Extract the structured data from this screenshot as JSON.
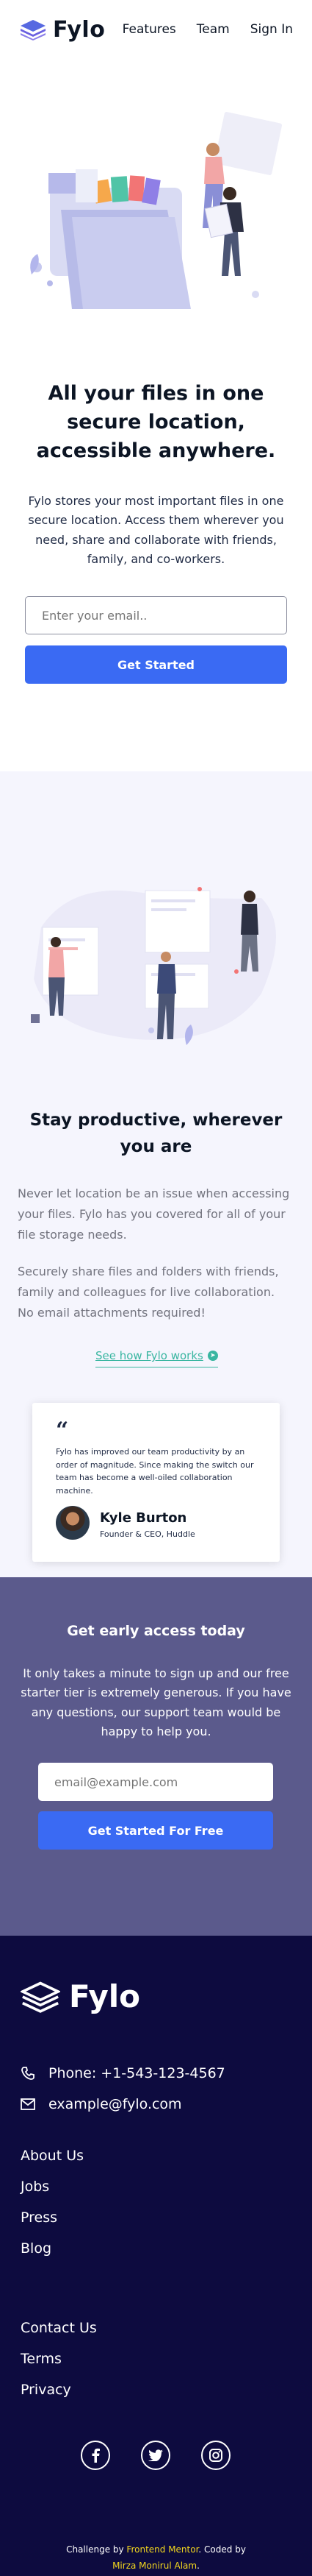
{
  "brand": {
    "name": "Fylo"
  },
  "nav": {
    "items": [
      "Features",
      "Team",
      "Sign In"
    ]
  },
  "hero": {
    "title": "All your files in one secure location, accessible anywhere.",
    "text": "Fylo stores your most important files in one secure location. Access them wherever you need, share and collaborate with friends, family, and co-workers.",
    "email_placeholder": "Enter your email..",
    "button": "Get Started"
  },
  "productive": {
    "title": "Stay productive, wherever you are",
    "p1": "Never let location be an issue when accessing your files. Fylo has you covered for all of your file storage needs.",
    "p2": "Securely share files and folders with friends, family and colleagues for live collaboration. No email attachments required!",
    "link": "See how Fylo works"
  },
  "testimonial": {
    "quote_mark": "“",
    "text": "Fylo has improved our team productivity by an order of magnitude. Since making the switch our team has become a well-oiled collaboration machine.",
    "name": "Kyle Burton",
    "role": "Founder & CEO, Huddle"
  },
  "early_access": {
    "title": "Get early access today",
    "text": "It only takes a minute to sign up and our free starter tier is extremely generous. If you have any questions, our support team would be happy to help you.",
    "email_placeholder": "email@example.com",
    "button": "Get Started For Free"
  },
  "footer": {
    "phone": "Phone: +1-543-123-4567",
    "email": "example@fylo.com",
    "links_1": [
      "About Us",
      "Jobs",
      "Press",
      "Blog"
    ],
    "links_2": [
      "Contact Us",
      "Terms",
      "Privacy"
    ],
    "social": [
      "facebook-icon",
      "twitter-icon",
      "instagram-icon"
    ],
    "credit": {
      "prefix": "Challenge by ",
      "source": "Frontend Mentor",
      "mid": ". Coded by ",
      "author": "Mirza Monirul Alam",
      "suffix": "."
    }
  },
  "colors": {
    "primary": "#3a6af3",
    "teal": "#3ab6a1",
    "early_bg": "#5b5a8c",
    "footer_bg": "#0d0b3f",
    "highlight": "#f2d61e"
  }
}
